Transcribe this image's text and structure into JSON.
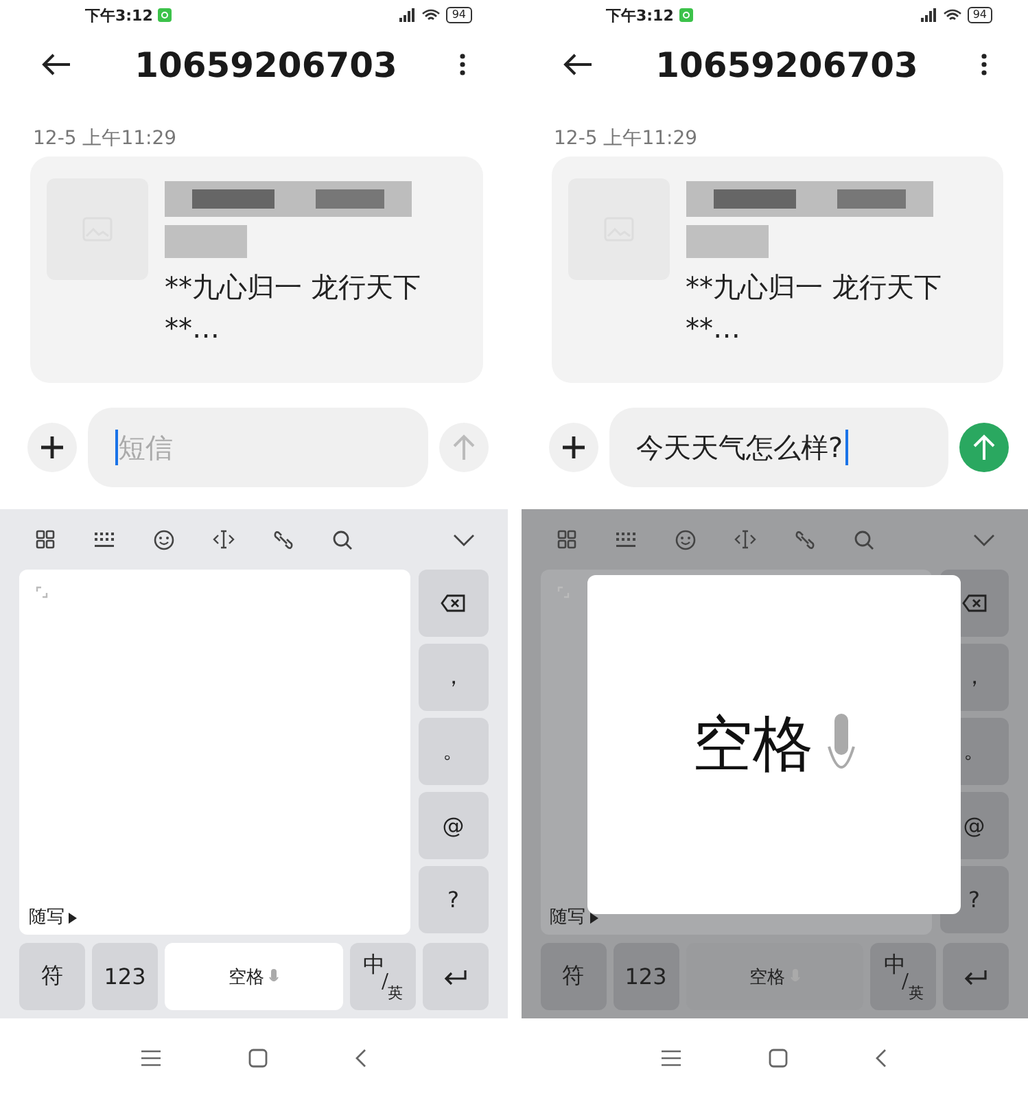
{
  "panels": [
    {
      "status_bar": {
        "time": "下午3:12",
        "battery": "94"
      },
      "header": {
        "title": "10659206703"
      },
      "date": "12-5 上午11:29",
      "message": {
        "body_lines": [
          "**九心归一 龙行天下",
          "**…"
        ]
      },
      "input": {
        "placeholder": "短信"
      },
      "send_enabled": false,
      "keyboard": {
        "dimmed": false,
        "pad_label": "随写",
        "side_keys": [
          "，",
          "。",
          "@",
          "?"
        ],
        "bottom_keys": [
          "符",
          "123"
        ],
        "space": "空格",
        "lang_main": "中",
        "lang_alt": "英"
      }
    },
    {
      "status_bar": {
        "time": "下午3:12",
        "battery": "94"
      },
      "header": {
        "title": "10659206703"
      },
      "date": "12-5 上午11:29",
      "message": {
        "body_lines": [
          "**九心归一 龙行天下",
          "**…"
        ]
      },
      "input": {
        "value": "今天天气怎么样?"
      },
      "send_enabled": true,
      "keyboard": {
        "dimmed": true,
        "pad_label": "随写",
        "side_keys": [
          "，",
          "。",
          "@",
          "?"
        ],
        "bottom_keys": [
          "符",
          "123"
        ],
        "space": "空格",
        "lang_main": "中",
        "lang_alt": "英",
        "preview": "空格"
      }
    }
  ]
}
